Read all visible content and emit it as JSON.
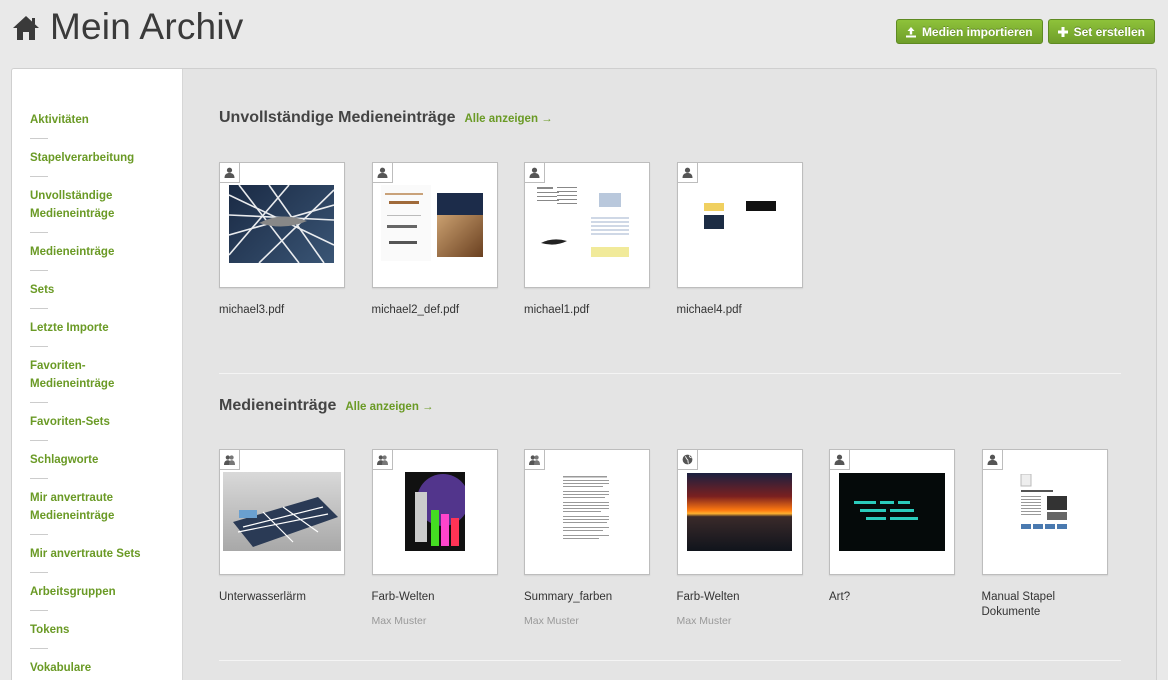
{
  "header": {
    "title": "Mein Archiv",
    "title_icon": "home-icon",
    "import_label": "Medien importieren",
    "create_set_label": "Set erstellen",
    "accent": "#7cb030"
  },
  "sidebar": {
    "items": [
      {
        "label": "Aktivitäten"
      },
      {
        "label": "Stapelverarbeitung"
      },
      {
        "label": "Unvollständige Medieneinträge"
      },
      {
        "label": "Medieneinträge"
      },
      {
        "label": "Sets"
      },
      {
        "label": "Letzte Importe"
      },
      {
        "label": "Favoriten-Medieneinträge"
      },
      {
        "label": "Favoriten-Sets"
      },
      {
        "label": "Schlagworte"
      },
      {
        "label": "Mir anvertraute Medieneinträge"
      },
      {
        "label": "Mir anvertraute Sets"
      },
      {
        "label": "Arbeitsgruppen"
      },
      {
        "label": "Tokens"
      },
      {
        "label": "Vokabulare"
      }
    ]
  },
  "incomplete": {
    "title": "Unvollständige Medieneinträge",
    "show_all": "Alle anzeigen →",
    "items": [
      {
        "title": "michael3.pdf",
        "badge": "user-icon"
      },
      {
        "title": "michael2_def.pdf",
        "badge": "user-icon"
      },
      {
        "title": "michael1.pdf",
        "badge": "user-icon"
      },
      {
        "title": "michael4.pdf",
        "badge": "user-icon"
      }
    ]
  },
  "entries": {
    "title": "Medieneinträge",
    "show_all": "Alle anzeigen →",
    "items": [
      {
        "title": "Unterwasserlärm",
        "owner": "",
        "badge": "group-icon"
      },
      {
        "title": "Farb-Welten",
        "owner": "Max Muster",
        "badge": "group-icon"
      },
      {
        "title": "Summary_farben",
        "owner": "Max Muster",
        "badge": "group-icon"
      },
      {
        "title": "Farb-Welten",
        "owner": "Max Muster",
        "badge": "globe-icon"
      },
      {
        "title": "Art?",
        "owner": "",
        "badge": "user-icon"
      },
      {
        "title": "Manual Stapel Dokumente",
        "owner": "",
        "badge": "user-icon"
      }
    ]
  }
}
